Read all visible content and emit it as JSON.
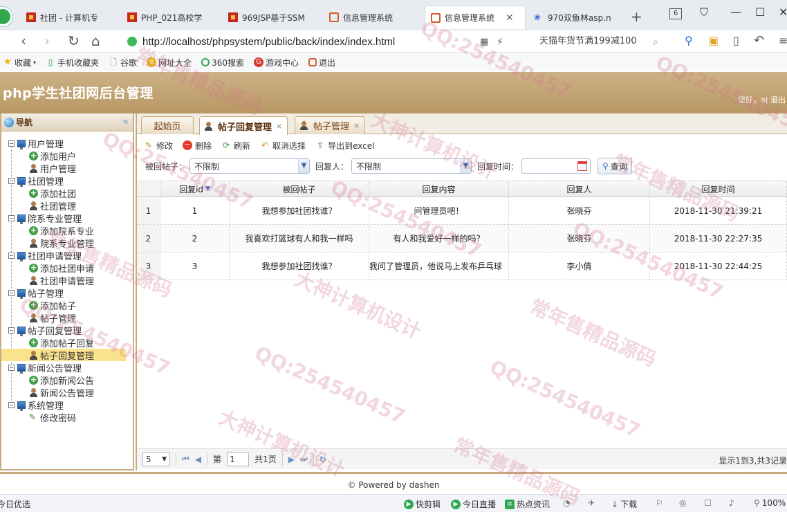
{
  "browser": {
    "tabs": [
      {
        "label": "社团 - 计算机专"
      },
      {
        "label": "PHP_021高校学"
      },
      {
        "label": "969JSP基于SSM"
      },
      {
        "label": "信息管理系统"
      },
      {
        "label": "信息管理系统",
        "active": true
      },
      {
        "label": "970双鱼林asp.n"
      }
    ],
    "tab_count": "6",
    "url": "http://localhost/phpsystem/public/back/index/index.html",
    "search_placeholder": "天猫年货节满199减100",
    "bookmarks": [
      "收藏",
      "手机收藏夹",
      "谷歌",
      "网址大全",
      "360搜索",
      "游戏中心",
      "退出"
    ]
  },
  "header": {
    "title": "php学生社团网后台管理",
    "welcome": "您好，a| 退出"
  },
  "sidebar": {
    "title": "导航",
    "groups": [
      {
        "label": "用户管理",
        "items": [
          "添加用户",
          "用户管理"
        ]
      },
      {
        "label": "社团管理",
        "items": [
          "添加社团",
          "社团管理"
        ]
      },
      {
        "label": "院系专业管理",
        "items": [
          "添加院系专业",
          "院系专业管理"
        ]
      },
      {
        "label": "社团申请管理",
        "items": [
          "添加社团申请",
          "社团申请管理"
        ]
      },
      {
        "label": "帖子管理",
        "items": [
          "添加帖子",
          "帖子管理"
        ]
      },
      {
        "label": "帖子回复管理",
        "items": [
          "添加帖子回复",
          "帖子回复管理"
        ]
      },
      {
        "label": "新闻公告管理",
        "items": [
          "添加新闻公告",
          "新闻公告管理"
        ]
      },
      {
        "label": "系统管理",
        "items": [
          "修改密码"
        ]
      }
    ],
    "selected": "帖子回复管理"
  },
  "panel_tabs": [
    {
      "label": "起始页",
      "closable": false
    },
    {
      "label": "帖子回复管理",
      "closable": true,
      "active": true
    },
    {
      "label": "帖子管理",
      "closable": true
    }
  ],
  "toolbar": {
    "edit": "修改",
    "delete": "删除",
    "refresh": "刷新",
    "unselect": "取消选择",
    "export": "导出到excel"
  },
  "filters": {
    "post_label": "被回帖子：",
    "post_value": "不限制",
    "user_label": "回复人：",
    "user_value": "不限制",
    "time_label": "回复时间：",
    "time_value": "",
    "query": "查询"
  },
  "grid": {
    "columns": [
      "回复id",
      "被回帖子",
      "回复内容",
      "回复人",
      "回复时间"
    ],
    "rows": [
      {
        "rn": "1",
        "id": "1",
        "post": "我想参加社团找谁？",
        "content": "问管理员吧！",
        "user": "张晓芬",
        "time": "2018-11-30 21:39:21"
      },
      {
        "rn": "2",
        "id": "2",
        "post": "我喜欢打篮球有人和我一样吗",
        "content": "有人和我爱好一样的吗？",
        "user": "张晓芬",
        "time": "2018-11-30 22:27:35"
      },
      {
        "rn": "3",
        "id": "3",
        "post": "我想参加社团找谁？",
        "content": "我问了管理员，他说马上发布乒乓球",
        "user": "李小倩",
        "time": "2018-11-30 22:44:25"
      }
    ]
  },
  "pager": {
    "page_size": "5",
    "page_prefix": "第",
    "page_value": "1",
    "page_total": "共1页",
    "info": "显示1到3,共3记录"
  },
  "footer": "© Powered by dashen",
  "statusbar": {
    "left": "今日优选",
    "items": [
      "快剪辑",
      "今日直播",
      "热点资讯",
      "下载",
      "100%"
    ]
  },
  "watermarks": [
    "QQ:254540457",
    "常年售精品源码",
    "大神计算机设计"
  ]
}
